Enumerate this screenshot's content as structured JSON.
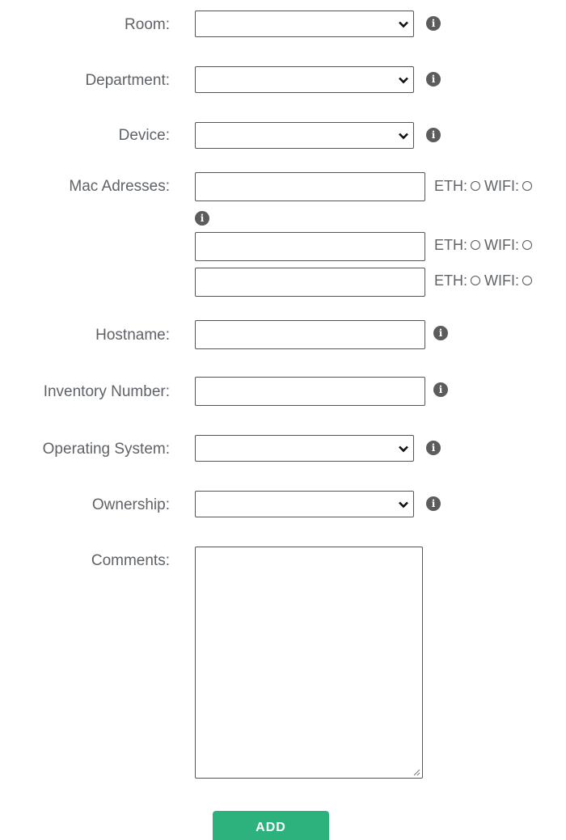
{
  "form": {
    "room": {
      "label": "Room:",
      "value": ""
    },
    "department": {
      "label": "Department:",
      "value": ""
    },
    "device": {
      "label": "Device:",
      "value": ""
    },
    "mac": {
      "label": "Mac Adresses:",
      "rows": [
        {
          "value": "",
          "eth_label": "ETH:",
          "wifi_label": "WIFI:"
        },
        {
          "value": "",
          "eth_label": "ETH:",
          "wifi_label": "WIFI:"
        },
        {
          "value": "",
          "eth_label": "ETH:",
          "wifi_label": "WIFI:"
        }
      ]
    },
    "hostname": {
      "label": "Hostname:",
      "value": ""
    },
    "inventory": {
      "label": "Inventory Number:",
      "value": ""
    },
    "os": {
      "label": "Operating System:",
      "value": ""
    },
    "ownership": {
      "label": "Ownership:",
      "value": ""
    },
    "comments": {
      "label": "Comments:",
      "value": ""
    },
    "info_icon_glyph": "i",
    "add_label": "ADD"
  },
  "colors": {
    "text": "#5f6368",
    "border": "#555555",
    "info_icon": "#5c5c5c",
    "add_button": "#2db27d"
  }
}
